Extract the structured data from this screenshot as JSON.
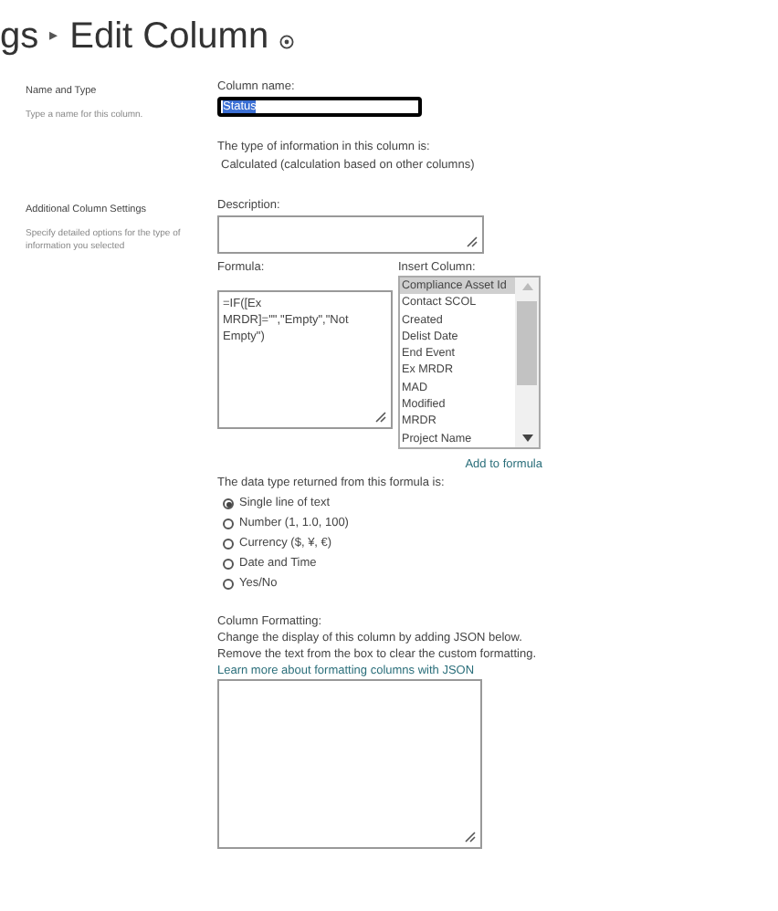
{
  "header": {
    "breadcrumb_partial": "gs",
    "separator": "▸",
    "title": "Edit Column"
  },
  "name_and_type": {
    "heading": "Name and Type",
    "description": "Type a name for this column.",
    "column_name_label": "Column name:",
    "column_name_value": "Status",
    "type_info_label": "The type of information in this column is:",
    "type_info_value": "Calculated (calculation based on other columns)"
  },
  "additional_settings": {
    "heading": "Additional Column Settings",
    "description": "Specify detailed options for the type of information you selected",
    "description_label": "Description:",
    "formula_label": "Formula:",
    "formula_value": "=IF([Ex MRDR]=\"\",\"Empty\",\"Not Empty\")",
    "insert_column_label": "Insert Column:",
    "insert_columns": [
      {
        "label": "Compliance Asset Id",
        "selected": true
      },
      {
        "label": "Contact SCOL",
        "selected": false
      },
      {
        "label": "Created",
        "selected": false
      },
      {
        "label": "Delist Date",
        "selected": false
      },
      {
        "label": "End Event",
        "selected": false
      },
      {
        "label": "Ex MRDR",
        "selected": false
      },
      {
        "label": "MAD",
        "selected": false
      },
      {
        "label": "Modified",
        "selected": false
      },
      {
        "label": "MRDR",
        "selected": false
      },
      {
        "label": "Project Name",
        "selected": false
      }
    ],
    "add_to_formula": "Add to formula",
    "return_type_label": "The data type returned from this formula is:",
    "return_types": [
      {
        "label": "Single line of text",
        "selected": true
      },
      {
        "label": "Number (1, 1.0, 100)",
        "selected": false
      },
      {
        "label": "Currency ($, ¥, €)",
        "selected": false
      },
      {
        "label": "Date and Time",
        "selected": false
      },
      {
        "label": "Yes/No",
        "selected": false
      }
    ],
    "formatting_label": "Column Formatting:",
    "formatting_lines": [
      "Change the display of this column by adding JSON below.",
      "Remove the text from the box to clear the custom formatting."
    ],
    "formatting_link": "Learn more about formatting columns with JSON"
  }
}
